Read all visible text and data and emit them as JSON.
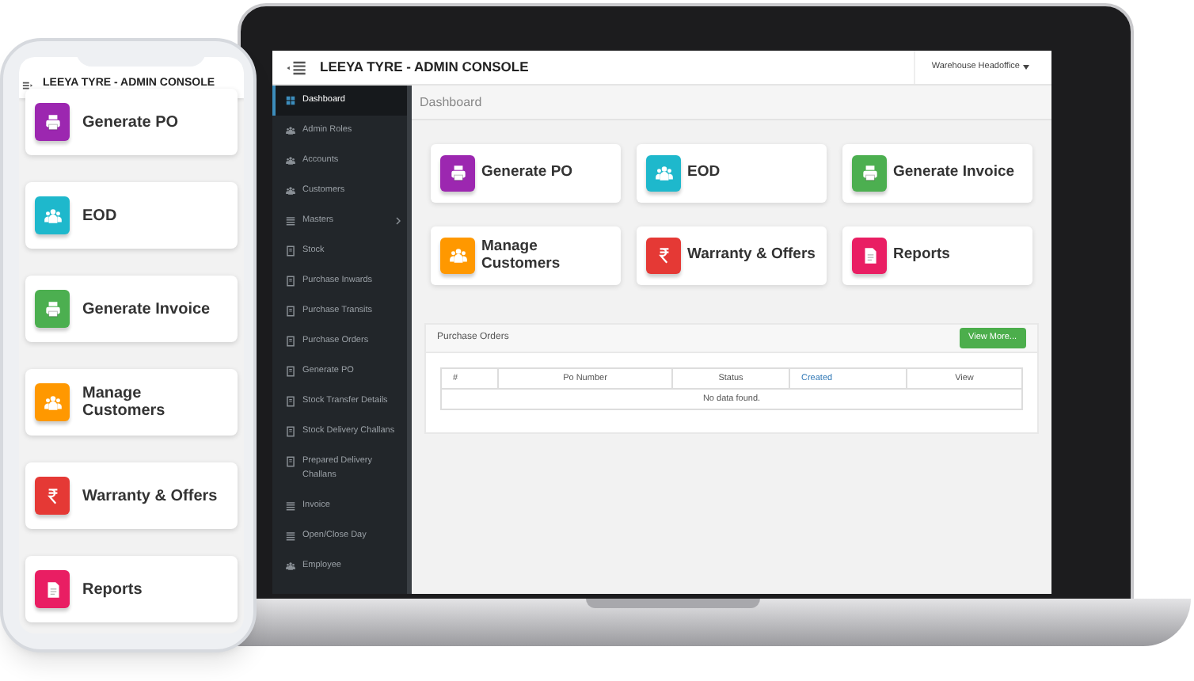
{
  "laptop": {
    "header": {
      "title": "LEEYA TYRE - ADMIN CONSOLE",
      "user_menu": "Warehouse Headoffice"
    },
    "sidebar": {
      "items": [
        {
          "label": "Dashboard",
          "kind": "grid",
          "selected": true,
          "has_submenu": false
        },
        {
          "label": "Admin Roles",
          "kind": "group",
          "selected": false,
          "has_submenu": false
        },
        {
          "label": "Accounts",
          "kind": "group",
          "selected": false,
          "has_submenu": false
        },
        {
          "label": "Customers",
          "kind": "group",
          "selected": false,
          "has_submenu": false
        },
        {
          "label": "Masters",
          "kind": "list",
          "selected": false,
          "has_submenu": true
        },
        {
          "label": "Stock",
          "kind": "document",
          "selected": false,
          "has_submenu": false
        },
        {
          "label": "Purchase Inwards",
          "kind": "document",
          "selected": false,
          "has_submenu": false
        },
        {
          "label": "Purchase Transits",
          "kind": "document",
          "selected": false,
          "has_submenu": false
        },
        {
          "label": "Purchase Orders",
          "kind": "document",
          "selected": false,
          "has_submenu": false
        },
        {
          "label": "Generate PO",
          "kind": "document",
          "selected": false,
          "has_submenu": false
        },
        {
          "label": "Stock Transfer Details",
          "kind": "document",
          "selected": false,
          "has_submenu": false
        },
        {
          "label": "Stock Delivery Challans",
          "kind": "document",
          "selected": false,
          "has_submenu": false
        },
        {
          "label": "Prepared Delivery Challans",
          "kind": "document",
          "selected": false,
          "has_submenu": false
        },
        {
          "label": "Invoice",
          "kind": "list",
          "selected": false,
          "has_submenu": false
        },
        {
          "label": "Open/Close Day",
          "kind": "list",
          "selected": false,
          "has_submenu": false
        },
        {
          "label": "Employee",
          "kind": "group",
          "selected": false,
          "has_submenu": false
        }
      ]
    },
    "breadcrumb": "Dashboard",
    "tiles": [
      {
        "label": "Generate PO",
        "kind": "printer",
        "color": "#9c27b0"
      },
      {
        "label": "EOD",
        "kind": "group",
        "color": "#1eb8cc"
      },
      {
        "label": "Generate Invoice",
        "kind": "printer",
        "color": "#4caf50"
      },
      {
        "label": "Manage Customers",
        "kind": "group",
        "color": "#ff9800"
      },
      {
        "label": "Warranty & Offers",
        "kind": "rupee",
        "color": "#e53935"
      },
      {
        "label": "Reports",
        "kind": "document",
        "color": "#e91e63"
      }
    ],
    "panel": {
      "title": "Purchase Orders",
      "button": "View More...",
      "table": {
        "columns": [
          {
            "label": "#",
            "link": false
          },
          {
            "label": "Po Number",
            "link": false
          },
          {
            "label": "Status",
            "link": false
          },
          {
            "label": "Created",
            "link": true
          },
          {
            "label": "View",
            "link": false
          }
        ],
        "empty_message": "No data found."
      }
    }
  },
  "phone": {
    "header": {
      "title": "LEEYA TYRE - ADMIN CONSOLE"
    },
    "tiles": [
      {
        "label": "Generate PO",
        "kind": "printer",
        "color": "#9c27b0"
      },
      {
        "label": "EOD",
        "kind": "group",
        "color": "#1eb8cc"
      },
      {
        "label": "Generate Invoice",
        "kind": "printer",
        "color": "#4caf50"
      },
      {
        "label": "Manage Customers",
        "kind": "group",
        "color": "#ff9800"
      },
      {
        "label": "Warranty & Offers",
        "kind": "rupee",
        "color": "#e53935"
      },
      {
        "label": "Reports",
        "kind": "document",
        "color": "#e91e63"
      }
    ]
  }
}
